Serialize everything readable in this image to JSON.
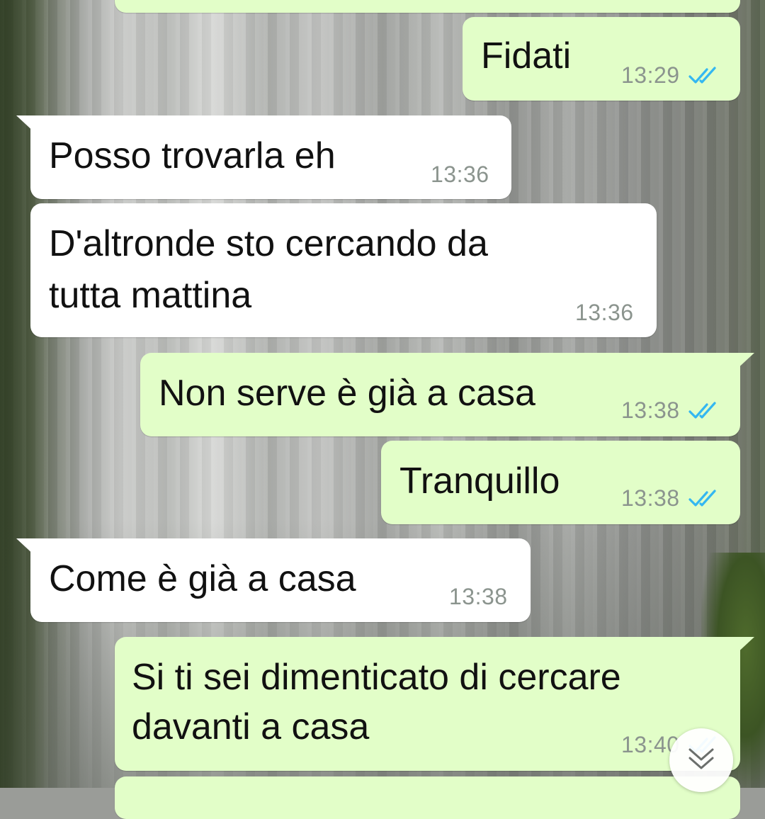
{
  "messages": [
    {
      "direction": "outgoing",
      "text": "Fidati",
      "time": "13:29",
      "status": "read"
    },
    {
      "direction": "incoming",
      "text": "Posso trovarla eh",
      "time": "13:36"
    },
    {
      "direction": "incoming",
      "text_line1": "D'altronde sto cercando da",
      "text_line2": "tutta mattina",
      "time": "13:36"
    },
    {
      "direction": "outgoing",
      "text": "Non serve è già a casa",
      "time": "13:38",
      "status": "read"
    },
    {
      "direction": "outgoing",
      "text": "Tranquillo",
      "time": "13:38",
      "status": "read"
    },
    {
      "direction": "incoming",
      "text": "Come è già a casa",
      "time": "13:38"
    },
    {
      "direction": "outgoing",
      "text_line1": "Si ti sei dimenticato di cercare",
      "text_line2": "davanti a casa",
      "time": "13:40",
      "status": "read"
    }
  ],
  "colors": {
    "outgoing_bubble": "#e2fec8",
    "incoming_bubble": "#ffffff",
    "read_ticks": "#34b7f1",
    "timestamp": "#8b948e"
  },
  "icons": {
    "read_receipt": "double-check-icon",
    "scroll_down": "chevron-double-down-icon"
  }
}
